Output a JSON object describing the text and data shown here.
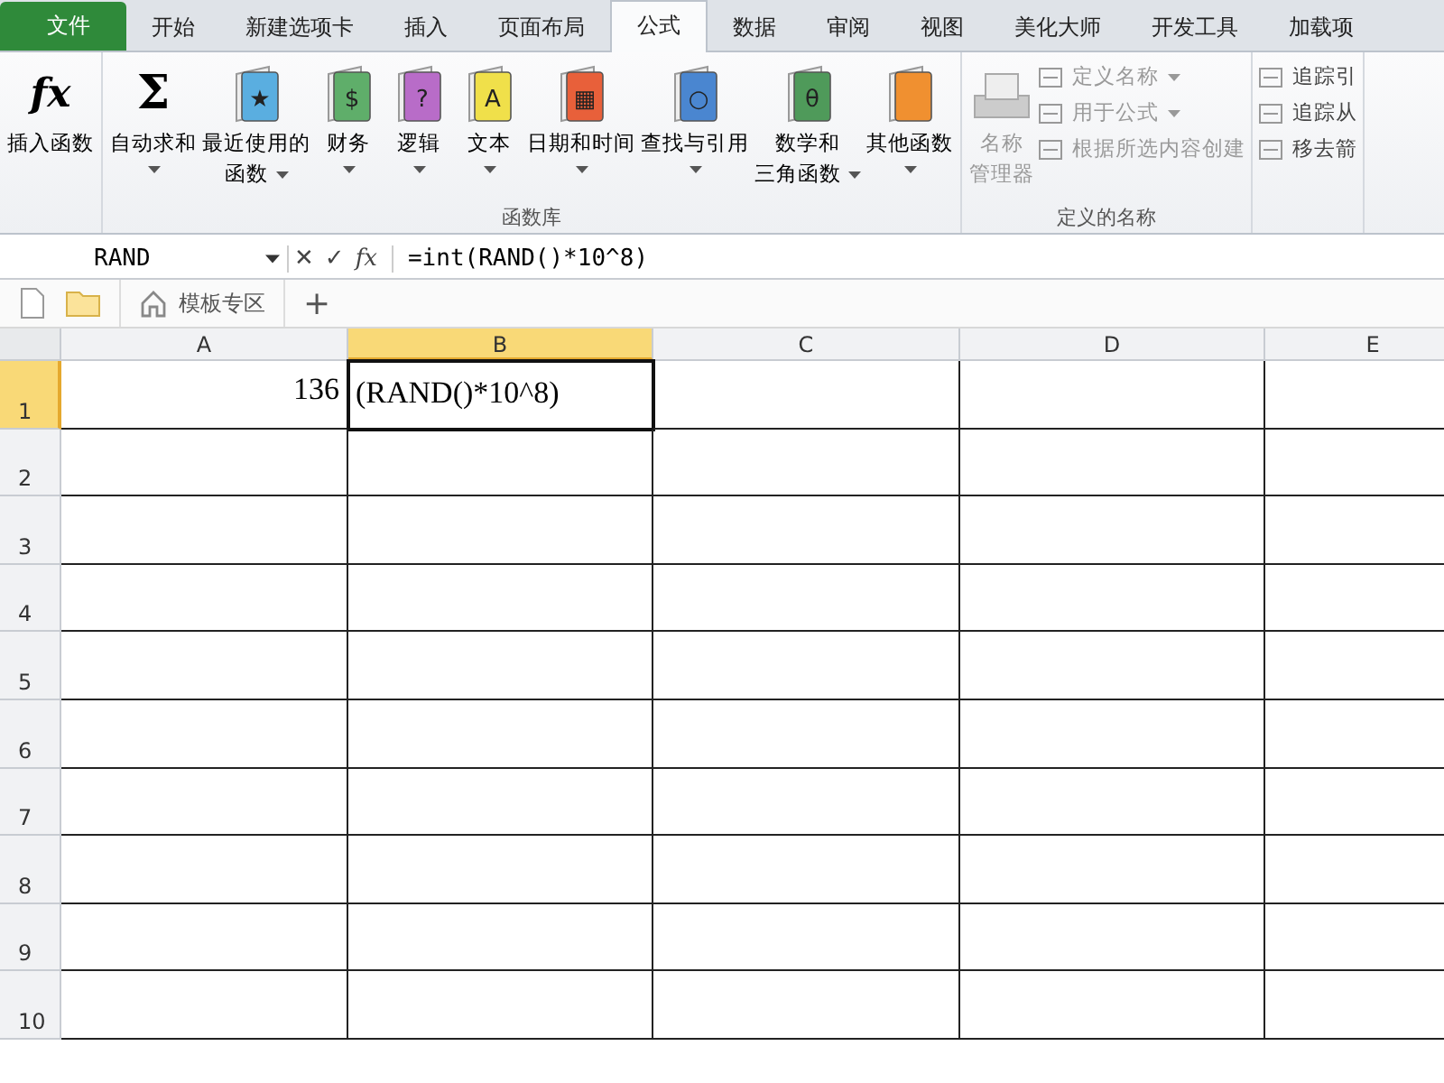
{
  "tabs": [
    {
      "label": "文件",
      "kind": "file",
      "selected": false
    },
    {
      "label": "开始",
      "kind": "tab",
      "selected": false
    },
    {
      "label": "新建选项卡",
      "kind": "tab",
      "selected": false
    },
    {
      "label": "插入",
      "kind": "tab",
      "selected": false
    },
    {
      "label": "页面布局",
      "kind": "tab",
      "selected": false
    },
    {
      "label": "公式",
      "kind": "tab",
      "selected": true
    },
    {
      "label": "数据",
      "kind": "tab",
      "selected": false
    },
    {
      "label": "审阅",
      "kind": "tab",
      "selected": false
    },
    {
      "label": "视图",
      "kind": "tab",
      "selected": false
    },
    {
      "label": "美化大师",
      "kind": "tab",
      "selected": false
    },
    {
      "label": "开发工具",
      "kind": "tab",
      "selected": false
    },
    {
      "label": "加载项",
      "kind": "tab",
      "selected": false
    }
  ],
  "ribbon_groups": [
    {
      "large": [
        {
          "kind": "fx",
          "glyph": "fx",
          "lines": [
            "插入函数"
          ],
          "dropdown": false
        }
      ]
    },
    {
      "label": "函数库",
      "large": [
        {
          "kind": "sigma",
          "glyph": "Σ",
          "lines": [
            "自动求和"
          ],
          "dropdown": true
        },
        {
          "kind": "book",
          "color": "#5aaee0",
          "glyph": "★",
          "lines": [
            "最近使用的",
            "函数"
          ],
          "dropdown": true
        },
        {
          "kind": "book",
          "color": "#5fae6a",
          "glyph": "$",
          "lines": [
            "财务"
          ],
          "dropdown": true
        },
        {
          "kind": "book",
          "color": "#b86cc8",
          "glyph": "?",
          "lines": [
            "逻辑"
          ],
          "dropdown": true
        },
        {
          "kind": "book",
          "color": "#f0e04a",
          "glyph": "A",
          "lines": [
            "文本"
          ],
          "dropdown": true
        },
        {
          "kind": "book",
          "color": "#e8603a",
          "glyph": "▦",
          "lines": [
            "日期和时间"
          ],
          "dropdown": true
        },
        {
          "kind": "book",
          "color": "#4a86d0",
          "glyph": "○",
          "lines": [
            "查找与引用"
          ],
          "dropdown": true
        },
        {
          "kind": "book",
          "color": "#4f9a5a",
          "glyph": "θ",
          "lines": [
            "数学和",
            "三角函数"
          ],
          "dropdown": true
        },
        {
          "kind": "book",
          "color": "#f09030",
          "lines": [
            "其他函数"
          ],
          "dropdown": true
        }
      ]
    },
    {
      "label": "定义的名称",
      "large": [
        {
          "kind": "names",
          "lines": [
            "名称",
            "管理器"
          ],
          "dropdown": false,
          "disabled": true
        }
      ],
      "small": [
        {
          "label": "定义名称",
          "dropdown": true,
          "disabled": true
        },
        {
          "label": "用于公式",
          "dropdown": true,
          "disabled": true
        },
        {
          "label": "根据所选内容创建",
          "dropdown": false,
          "disabled": true
        }
      ]
    },
    {
      "small": [
        {
          "label": "追踪引",
          "dropdown": false,
          "disabled": false
        },
        {
          "label": "追踪从",
          "dropdown": false,
          "disabled": false
        },
        {
          "label": "移去箭",
          "dropdown": false,
          "disabled": false
        }
      ]
    }
  ],
  "formula_bar": {
    "name_box": "RAND",
    "buttons": [
      "✕",
      "✓",
      "fx"
    ],
    "formula": "=int(RAND()*10^8)"
  },
  "doc_tabs": [
    {
      "label": "模板专区"
    }
  ],
  "add_tab": "+",
  "columns": [
    {
      "label": "A",
      "selected": false
    },
    {
      "label": "B",
      "selected": true
    },
    {
      "label": "C",
      "selected": false
    },
    {
      "label": "D",
      "selected": false
    },
    {
      "label": "E",
      "selected": false
    }
  ],
  "rows": [
    {
      "label": "1",
      "selected": true,
      "cells": [
        {
          "kind": "number",
          "value": "136"
        },
        {
          "kind": "text",
          "value": "(RAND()*10^8)",
          "active": true
        }
      ]
    },
    {
      "label": "2",
      "selected": false,
      "cells": []
    },
    {
      "label": "3",
      "selected": false,
      "cells": []
    },
    {
      "label": "4",
      "selected": false,
      "cells": []
    },
    {
      "label": "5",
      "selected": false,
      "cells": []
    },
    {
      "label": "6",
      "selected": false,
      "cells": []
    },
    {
      "label": "7",
      "selected": false,
      "cells": []
    },
    {
      "label": "8",
      "selected": false,
      "cells": []
    },
    {
      "label": "9",
      "selected": false,
      "cells": []
    },
    {
      "label": "10",
      "selected": false,
      "cells": []
    }
  ]
}
